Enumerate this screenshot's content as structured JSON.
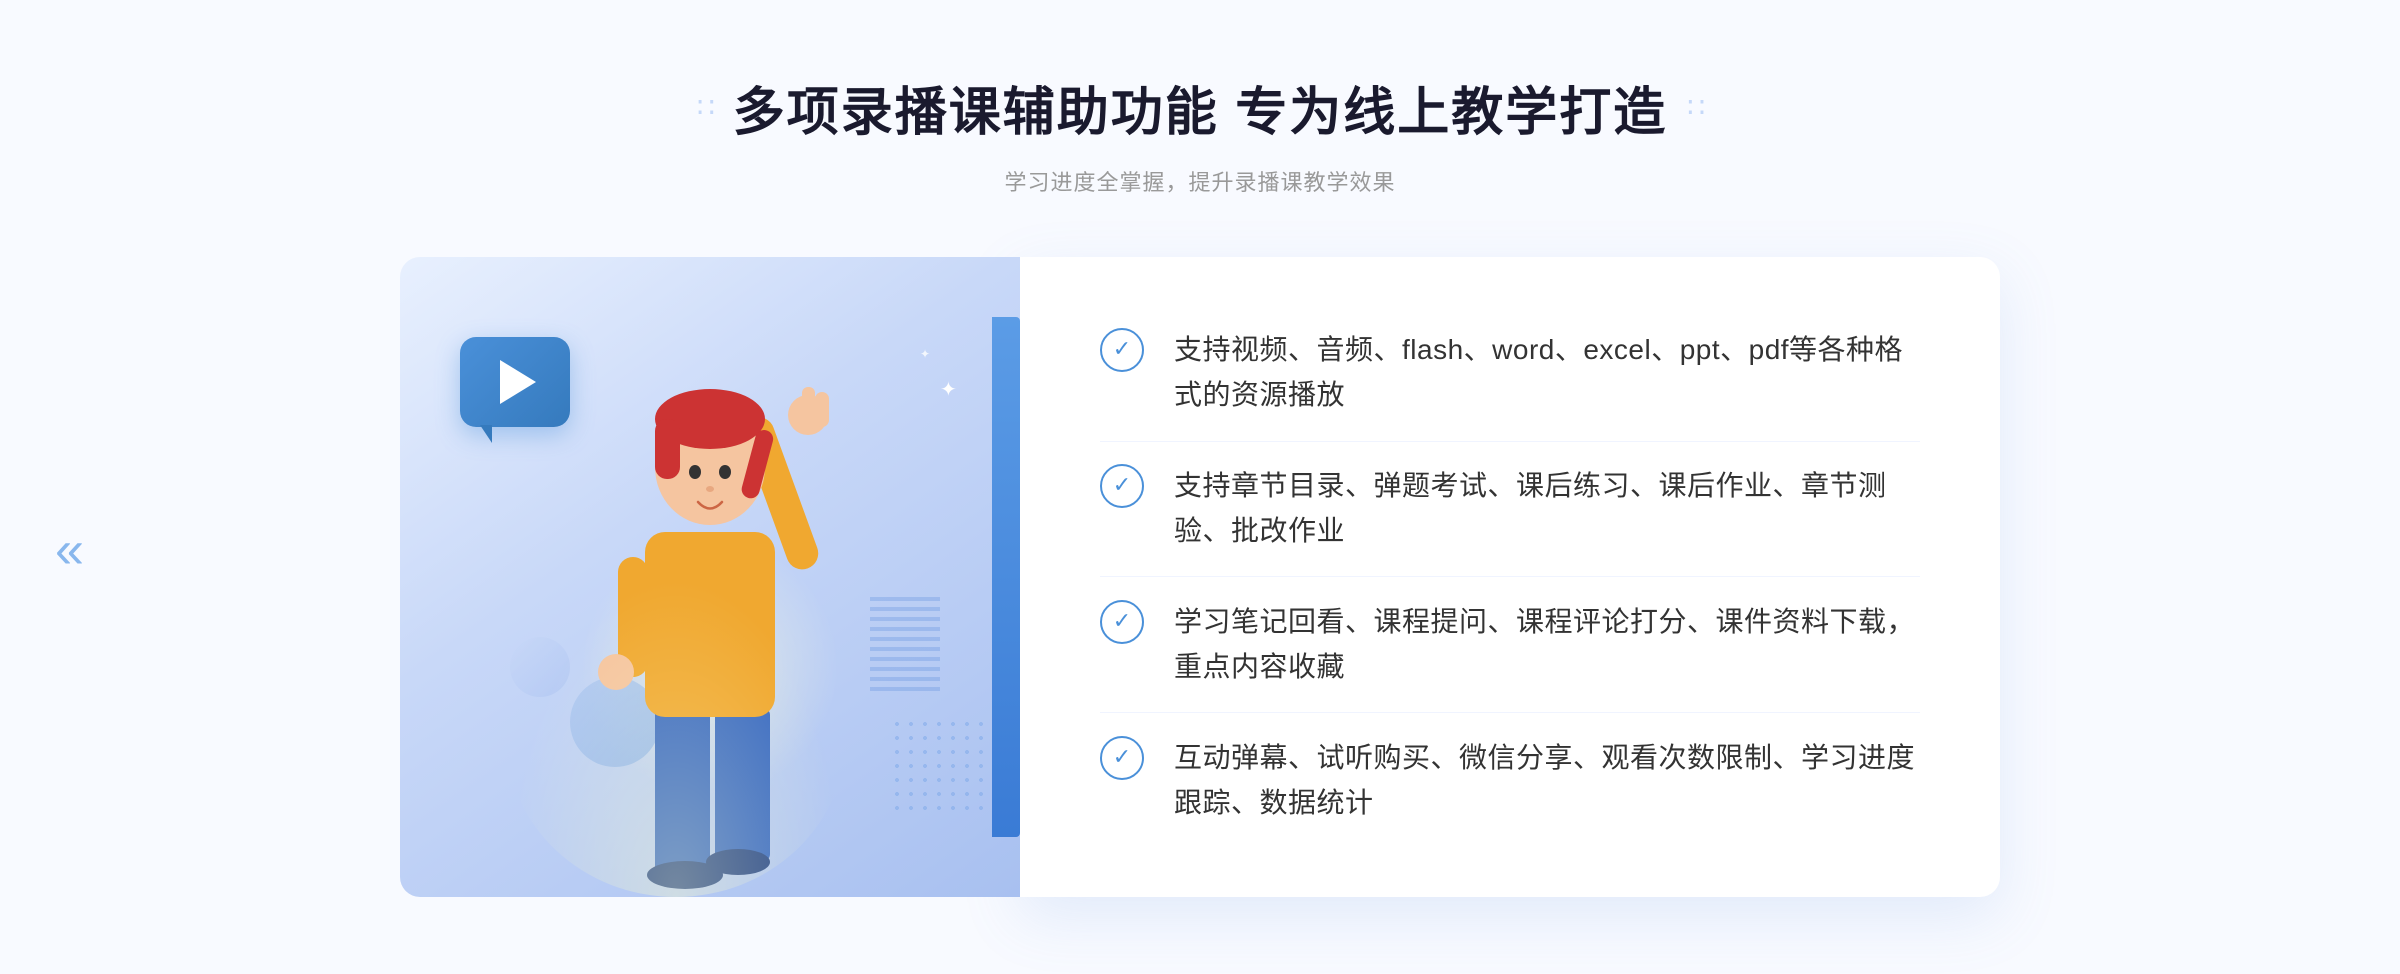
{
  "header": {
    "title": "多项录播课辅助功能 专为线上教学打造",
    "subtitle": "学习进度全掌握，提升录播课教学效果",
    "title_decorator_left": "∷",
    "title_decorator_right": "∷"
  },
  "features": [
    {
      "id": "feature-1",
      "text": "支持视频、音频、flash、word、excel、ppt、pdf等各种格式的资源播放"
    },
    {
      "id": "feature-2",
      "text": "支持章节目录、弹题考试、课后练习、课后作业、章节测验、批改作业"
    },
    {
      "id": "feature-3",
      "text": "学习笔记回看、课程提问、课程评论打分、课件资料下载，重点内容收藏"
    },
    {
      "id": "feature-4",
      "text": "互动弹幕、试听购买、微信分享、观看次数限制、学习进度跟踪、数据统计"
    }
  ],
  "colors": {
    "primary_blue": "#4a90d9",
    "light_blue": "#e8f1fd",
    "text_dark": "#1a1a2e",
    "text_gray": "#999999",
    "text_body": "#333333",
    "accent_blue": "#5b9ce6"
  },
  "icons": {
    "check": "✓",
    "play": "▶",
    "chevron_left": "«",
    "decorator": "∷"
  }
}
